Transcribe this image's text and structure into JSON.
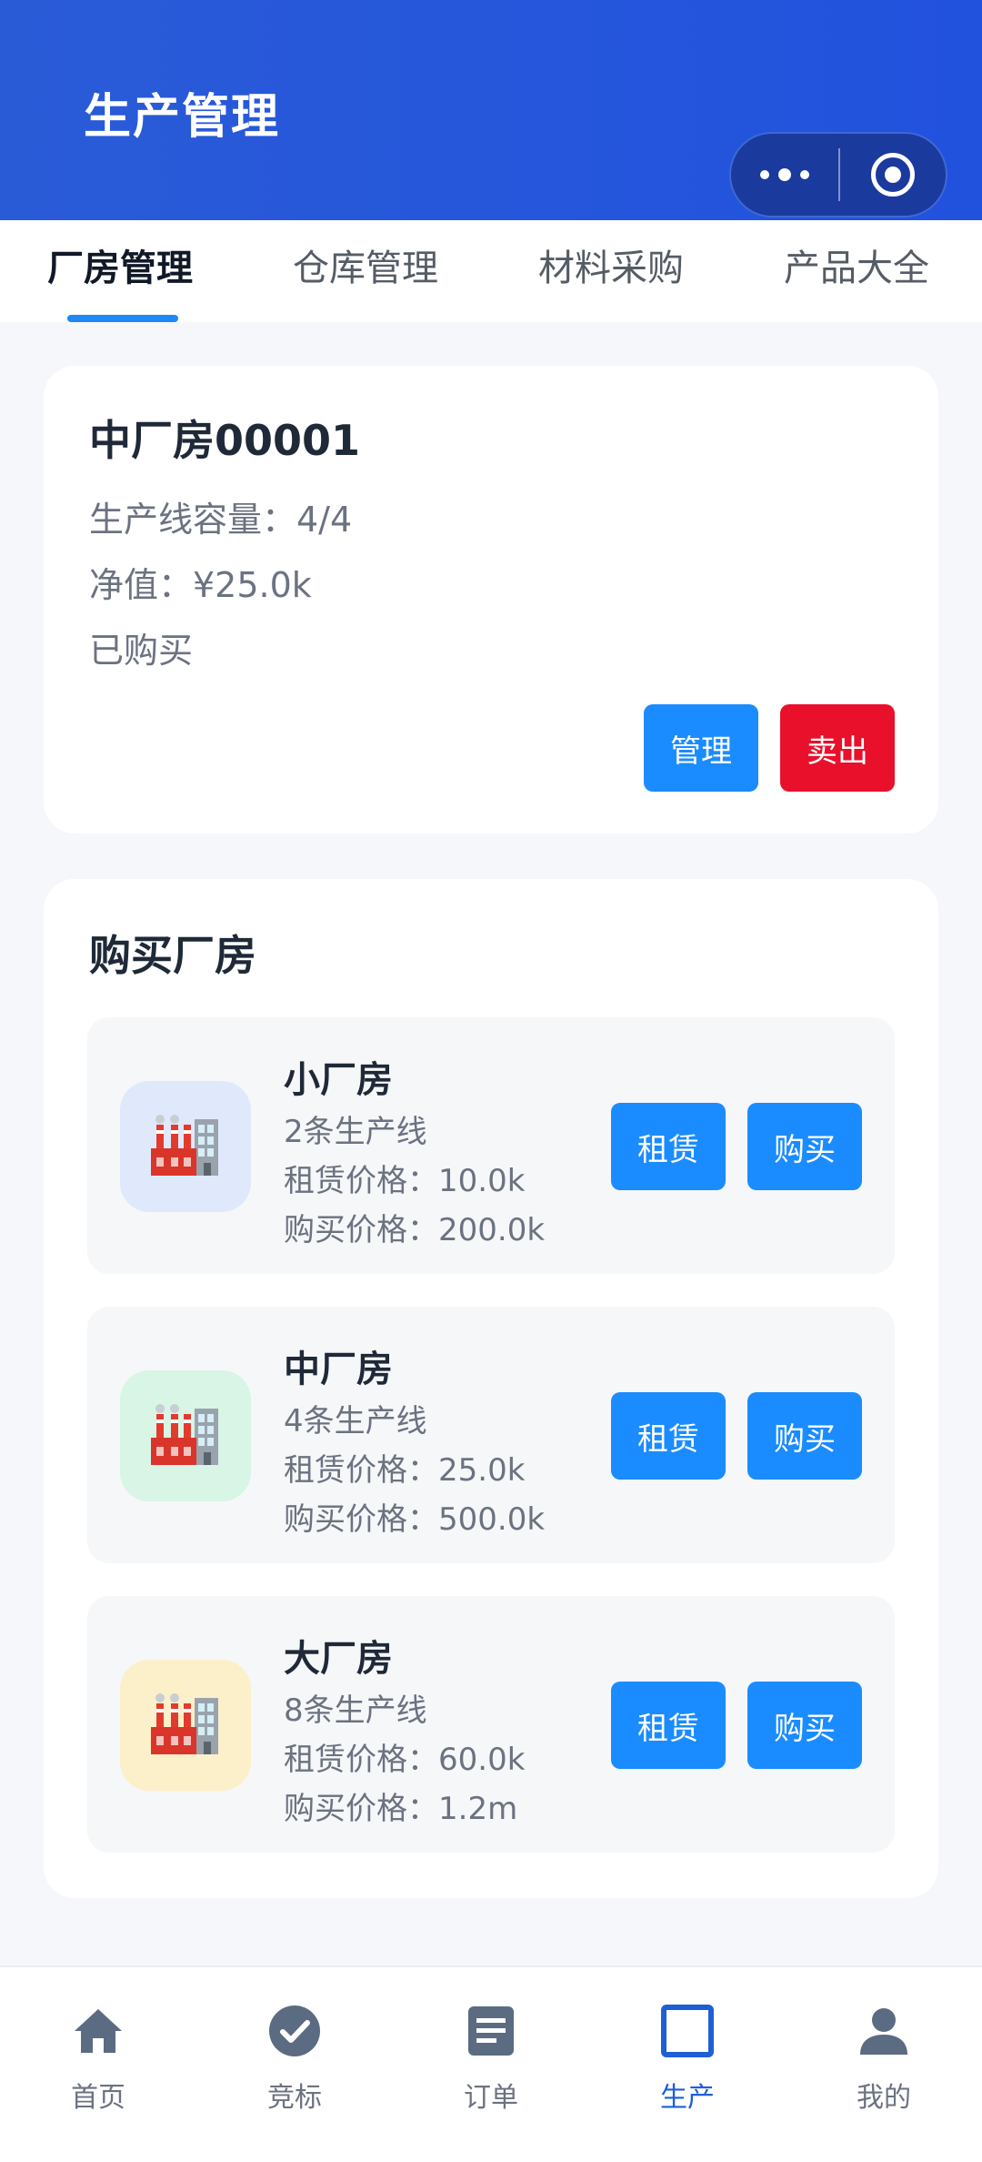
{
  "header": {
    "title": "生产管理"
  },
  "tabs": [
    "厂房管理",
    "仓库管理",
    "材料采购",
    "产品大全"
  ],
  "owned": {
    "name": "中厂房00001",
    "capacity": "生产线容量：4/4",
    "net_value": "净值：¥25.0k",
    "status": "已购买",
    "manage_label": "管理",
    "sell_label": "卖出"
  },
  "buy": {
    "title": "购买厂房",
    "rent_label": "租赁",
    "buy_label": "购买",
    "items": [
      {
        "name": "小厂房",
        "lines": "2条生产线",
        "rent": "租赁价格：10.0k",
        "price": "购买价格：200.0k",
        "icon": "factory-icon",
        "bg": "#dfe9fb"
      },
      {
        "name": "中厂房",
        "lines": "4条生产线",
        "rent": "租赁价格：25.0k",
        "price": "购买价格：500.0k",
        "icon": "factory-icon",
        "bg": "#d8f5e6"
      },
      {
        "name": "大厂房",
        "lines": "8条生产线",
        "rent": "租赁价格：60.0k",
        "price": "购买价格：1.2m",
        "icon": "factory-icon",
        "bg": "#fbf0c9"
      }
    ]
  },
  "nav": [
    {
      "label": "首页",
      "icon": "home-icon"
    },
    {
      "label": "竞标",
      "icon": "check-circle-icon"
    },
    {
      "label": "订单",
      "icon": "document-icon"
    },
    {
      "label": "生产",
      "icon": "square-icon",
      "active": true
    },
    {
      "label": "我的",
      "icon": "user-icon"
    }
  ],
  "colors": {
    "primary": "#1a8cff",
    "danger": "#e8102b",
    "header": "#2152de",
    "active_nav": "#1e5fd6"
  }
}
